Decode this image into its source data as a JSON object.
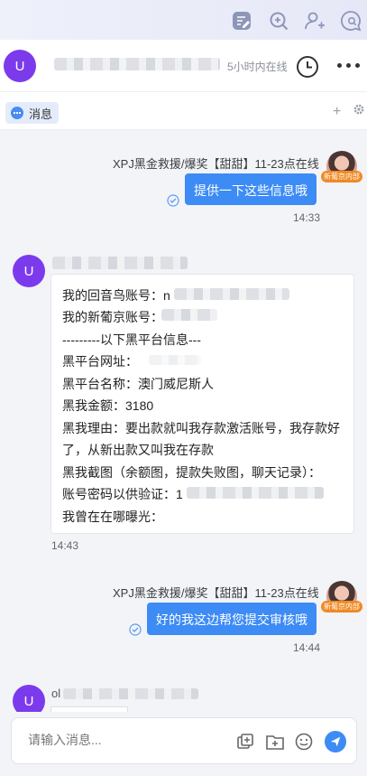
{
  "topbar": {
    "icons": [
      "note-edit-icon",
      "search-zoom-icon",
      "add-user-icon",
      "chat-search-icon"
    ]
  },
  "header": {
    "avatar_letter": "U",
    "status": "5小时内在线",
    "actions": [
      "clock-icon",
      "more-icon"
    ]
  },
  "tabs": {
    "active_label": "消息",
    "plus_label": "+"
  },
  "messages": [
    {
      "direction": "out",
      "sender": "XPJ黑金救援/爆奖【甜甜】11-23点在线",
      "badge": "新葡京内部",
      "text": "提供一下这些信息哦",
      "time": "14:33"
    },
    {
      "direction": "in",
      "avatar_letter": "U",
      "lines": [
        "我的回音鸟账号：n",
        "我的新葡京账号：",
        "---------以下黑平台信息---",
        "黑平台网址：",
        "黑平台名称：澳门威尼斯人",
        "黑我金额：3180",
        "黑我理由：要出款就叫我存款激活账号，我存款好",
        "了，从新出款又叫我在存款",
        "黑我截图（余额图，提款失败图，聊天记录）：",
        "账号密码以供验证：1",
        "我曾在在哪曝光："
      ],
      "time": "14:43"
    },
    {
      "direction": "out",
      "sender": "XPJ黑金救援/爆奖【甜甜】11-23点在线",
      "badge": "新葡京内部",
      "text": "好的我这边帮您提交审核哦",
      "time": "14:44"
    },
    {
      "direction": "in",
      "avatar_letter": "U",
      "sender_prefix": "ol"
    }
  ],
  "composer": {
    "placeholder": "请输入消息...",
    "tools": [
      "screenshot-icon",
      "folder-upload-icon",
      "emoji-icon",
      "send-icon"
    ]
  },
  "colors": {
    "accent": "#3d8bf5",
    "avatar": "#7c3aed",
    "badge": "#f08a24"
  }
}
